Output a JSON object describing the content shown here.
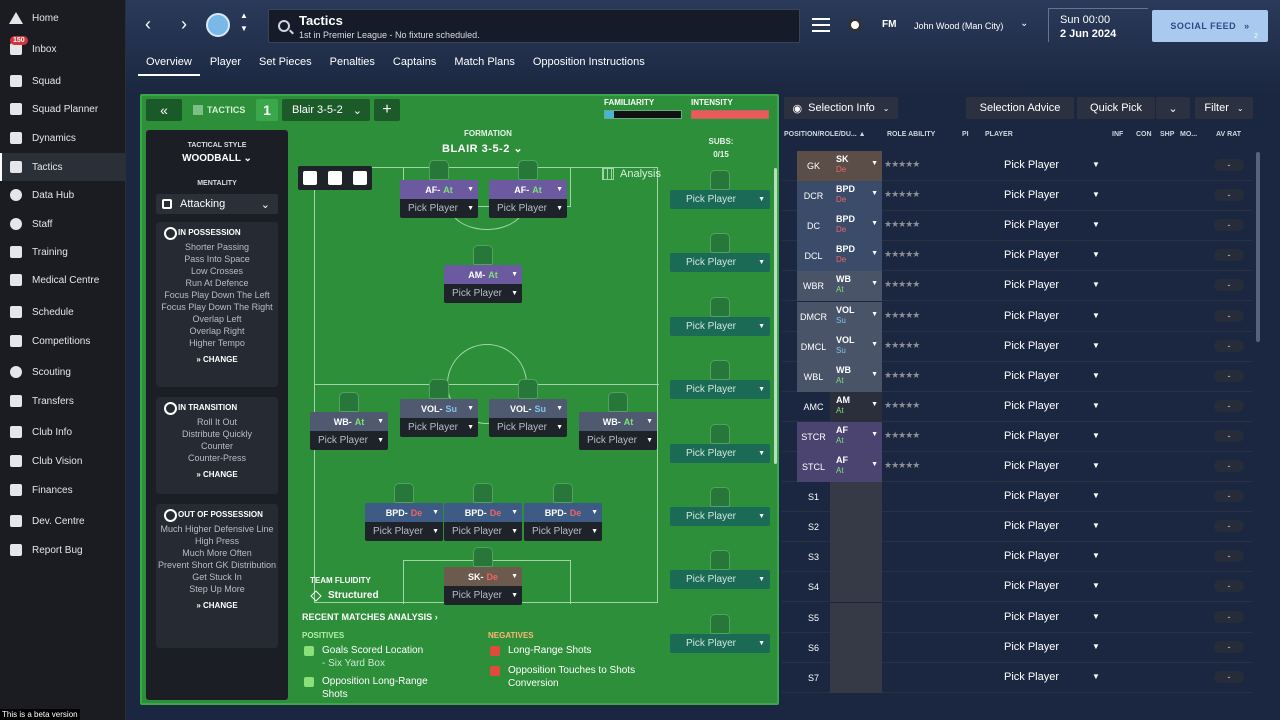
{
  "sidebar": {
    "items": [
      {
        "label": "Home",
        "icon": "home-icon"
      },
      {
        "label": "Inbox",
        "icon": "inbox-icon",
        "badge": "150"
      },
      {
        "label": "Squad",
        "icon": "squad-icon"
      },
      {
        "label": "Squad Planner",
        "icon": "planner-icon"
      },
      {
        "label": "Dynamics",
        "icon": "dynamics-icon"
      },
      {
        "label": "Tactics",
        "icon": "tactics-icon"
      },
      {
        "label": "Data Hub",
        "icon": "data-hub-icon"
      },
      {
        "label": "Staff",
        "icon": "staff-icon"
      },
      {
        "label": "Training",
        "icon": "training-icon"
      },
      {
        "label": "Medical Centre",
        "icon": "medical-icon"
      },
      {
        "label": "Schedule",
        "icon": "calendar-icon"
      },
      {
        "label": "Competitions",
        "icon": "trophy-icon"
      },
      {
        "label": "Scouting",
        "icon": "scouting-icon"
      },
      {
        "label": "Transfers",
        "icon": "transfers-icon"
      },
      {
        "label": "Club Info",
        "icon": "shield-icon"
      },
      {
        "label": "Club Vision",
        "icon": "briefcase-icon"
      },
      {
        "label": "Finances",
        "icon": "finances-icon"
      },
      {
        "label": "Dev. Centre",
        "icon": "dev-centre-icon"
      },
      {
        "label": "Report Bug",
        "icon": "alert-icon"
      }
    ],
    "beta_text": "This is a beta version"
  },
  "header": {
    "title": "Tactics",
    "subtitle": "1st in Premier League - No fixture scheduled.",
    "fm_logo": "FM",
    "manager": "John Wood (Man City)",
    "time": "Sun 00:00",
    "date": "2 Jun 2024",
    "social_feed": "SOCIAL FEED",
    "social_badge": "2"
  },
  "tabs": [
    "Overview",
    "Player",
    "Set Pieces",
    "Penalties",
    "Captains",
    "Match Plans",
    "Opposition Instructions"
  ],
  "toolbar": {
    "tactics_label": "TACTICS",
    "tactic_number": "1",
    "tactic_name": "Blair 3-5-2",
    "familiarity_label": "FAMILIARITY",
    "familiarity_level": 0.12,
    "intensity_label": "INTENSITY",
    "intensity_level": 1.0
  },
  "style": {
    "tactical_style_label": "TACTICAL STYLE",
    "tactical_style": "WOODBALL",
    "mentality_label": "MENTALITY",
    "mentality": "Attacking",
    "in_possession": {
      "title": "IN POSSESSION",
      "items": [
        "Shorter Passing",
        "Pass Into Space",
        "Low Crosses",
        "Run At Defence",
        "Focus Play Down The Left",
        "Focus Play Down The Right",
        "Overlap Left",
        "Overlap Right",
        "Higher Tempo"
      ],
      "change": "CHANGE"
    },
    "in_transition": {
      "title": "IN TRANSITION",
      "items": [
        "Roll It Out",
        "Distribute Quickly",
        "Counter",
        "Counter-Press"
      ],
      "change": "CHANGE"
    },
    "out_of_possession": {
      "title": "OUT OF POSSESSION",
      "items": [
        "Much Higher Defensive Line",
        "High Press",
        "Much More Often",
        "Prevent Short GK Distribution",
        "Get Stuck In",
        "Step Up More"
      ],
      "change": "CHANGE"
    }
  },
  "pitch": {
    "formation_label": "FORMATION",
    "formation_name": "BLAIR 3-5-2",
    "analysis": "Analysis",
    "subs_label": "SUBS:",
    "subs_count": "0/15",
    "slots": [
      {
        "role": "AF",
        "duty": "At",
        "player": "Pick Player"
      },
      {
        "role": "AF",
        "duty": "At",
        "player": "Pick Player"
      },
      {
        "role": "AM",
        "duty": "At",
        "player": "Pick Player"
      },
      {
        "role": "WB",
        "duty": "At",
        "player": "Pick Player"
      },
      {
        "role": "VOL",
        "duty": "Su",
        "player": "Pick Player"
      },
      {
        "role": "VOL",
        "duty": "Su",
        "player": "Pick Player"
      },
      {
        "role": "WB",
        "duty": "At",
        "player": "Pick Player"
      },
      {
        "role": "BPD",
        "duty": "De",
        "player": "Pick Player"
      },
      {
        "role": "BPD",
        "duty": "De",
        "player": "Pick Player"
      },
      {
        "role": "BPD",
        "duty": "De",
        "player": "Pick Player"
      },
      {
        "role": "SK",
        "duty": "De",
        "player": "Pick Player"
      }
    ],
    "subs": [
      "Pick Player",
      "Pick Player",
      "Pick Player",
      "Pick Player",
      "Pick Player",
      "Pick Player",
      "Pick Player",
      "Pick Player",
      "Pick Player",
      "Pick Player"
    ],
    "team_fluidity_label": "TEAM FLUIDITY",
    "team_fluidity": "Structured"
  },
  "analysis": {
    "title": "RECENT MATCHES ANALYSIS",
    "positives_label": "POSITIVES",
    "negatives_label": "NEGATIVES",
    "positives": [
      {
        "text": "Goals Scored Location",
        "sub": "- Six Yard Box"
      },
      {
        "text": "Opposition Long-Range Shots",
        "sub": ""
      }
    ],
    "negatives": [
      {
        "text": "Long-Range Shots",
        "sub": ""
      },
      {
        "text": "Opposition Touches to Shots Conversion",
        "sub": ""
      }
    ]
  },
  "squad": {
    "selection_info": "Selection Info",
    "selection_advice": "Selection Advice",
    "quick_pick": "Quick Pick",
    "filter": "Filter",
    "headers": {
      "position": "POSITION/ROLE/DU...",
      "role_ability": "ROLE ABILITY",
      "pi": "PI",
      "player": "PLAYER",
      "inf": "INF",
      "con": "CON",
      "shp": "SHP",
      "mo": "MO...",
      "av_rat": "AV RAT"
    },
    "rows": [
      {
        "pos": "GK",
        "role": "SK",
        "duty": "De",
        "player": "Pick Player",
        "av": "-"
      },
      {
        "pos": "DCR",
        "role": "BPD",
        "duty": "De",
        "player": "Pick Player",
        "av": "-"
      },
      {
        "pos": "DC",
        "role": "BPD",
        "duty": "De",
        "player": "Pick Player",
        "av": "-"
      },
      {
        "pos": "DCL",
        "role": "BPD",
        "duty": "De",
        "player": "Pick Player",
        "av": "-"
      },
      {
        "pos": "WBR",
        "role": "WB",
        "duty": "At",
        "player": "Pick Player",
        "av": "-"
      },
      {
        "pos": "DMCR",
        "role": "VOL",
        "duty": "Su",
        "player": "Pick Player",
        "av": "-"
      },
      {
        "pos": "DMCL",
        "role": "VOL",
        "duty": "Su",
        "player": "Pick Player",
        "av": "-"
      },
      {
        "pos": "WBL",
        "role": "WB",
        "duty": "At",
        "player": "Pick Player",
        "av": "-"
      },
      {
        "pos": "AMC",
        "role": "AM",
        "duty": "At",
        "player": "Pick Player",
        "av": "-"
      },
      {
        "pos": "STCR",
        "role": "AF",
        "duty": "At",
        "player": "Pick Player",
        "av": "-"
      },
      {
        "pos": "STCL",
        "role": "AF",
        "duty": "At",
        "player": "Pick Player",
        "av": "-"
      },
      {
        "pos": "S1",
        "role": "",
        "duty": "",
        "player": "Pick Player",
        "av": "-"
      },
      {
        "pos": "S2",
        "role": "",
        "duty": "",
        "player": "Pick Player",
        "av": "-"
      },
      {
        "pos": "S3",
        "role": "",
        "duty": "",
        "player": "Pick Player",
        "av": "-"
      },
      {
        "pos": "S4",
        "role": "",
        "duty": "",
        "player": "Pick Player",
        "av": "-"
      },
      {
        "pos": "S5",
        "role": "",
        "duty": "",
        "player": "Pick Player",
        "av": "-"
      },
      {
        "pos": "S6",
        "role": "",
        "duty": "",
        "player": "Pick Player",
        "av": "-"
      },
      {
        "pos": "S7",
        "role": "",
        "duty": "",
        "player": "Pick Player",
        "av": "-"
      }
    ]
  },
  "colors": {
    "pitch": "#2d8f3a",
    "attack_role": "#6b5aa0",
    "defence_role": "#3d5b84",
    "social_feed": "#a9c9ef"
  }
}
